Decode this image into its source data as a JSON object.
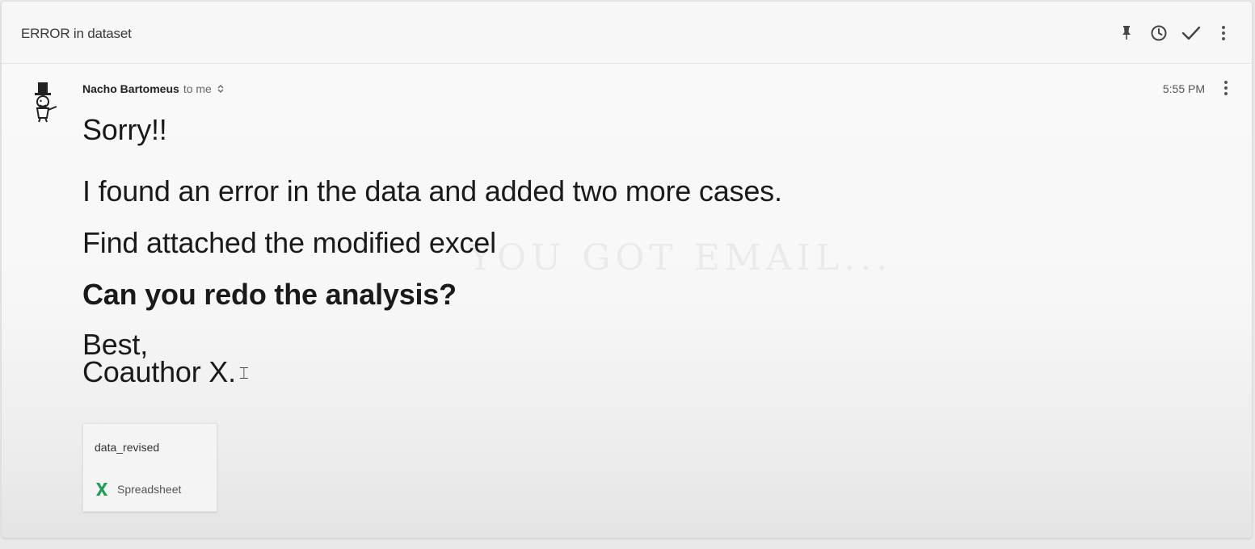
{
  "header": {
    "subject": "ERROR in dataset",
    "toolbar": [
      {
        "name": "pin-icon",
        "label": "Pin"
      },
      {
        "name": "snooze-clock-icon",
        "label": "Snooze"
      },
      {
        "name": "done-check-icon",
        "label": "Done"
      },
      {
        "name": "more-vertical-icon",
        "label": "More"
      }
    ]
  },
  "message": {
    "sender": "Nacho Bartomeus",
    "recipient": "to me",
    "time": "5:55 PM",
    "greeting": "Sorry!!",
    "line1": "I found an error in the data and added two more cases.",
    "line2": "Find attached the modified excel",
    "question": "Can you redo the analysis?",
    "signoff": "Best,",
    "signature": "Coauthor X."
  },
  "attachment": {
    "name": "data_revised",
    "type": "Spreadsheet",
    "icon": "excel-x-icon",
    "icon_color": "#1f9d55"
  },
  "watermark": "YOU GOT EMAIL..."
}
